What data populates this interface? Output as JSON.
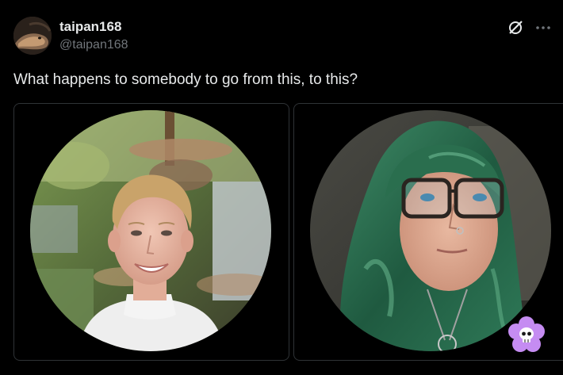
{
  "author": {
    "display_name": "taipan168",
    "handle": "@taipan168"
  },
  "tweet": {
    "text": "What happens to somebody to go from this, to this?"
  },
  "icons": {
    "avatar": "snake-avatar",
    "grok": "grok-icon",
    "more": "more-icon",
    "sticker": "flower-skull-sticker"
  },
  "media": [
    {
      "name": "before-photo"
    },
    {
      "name": "after-photo"
    }
  ],
  "colors": {
    "background": "#000000",
    "text": "#e7e9ea",
    "muted": "#71767b",
    "border": "#2f3336",
    "sticker": "#c58cf2"
  }
}
